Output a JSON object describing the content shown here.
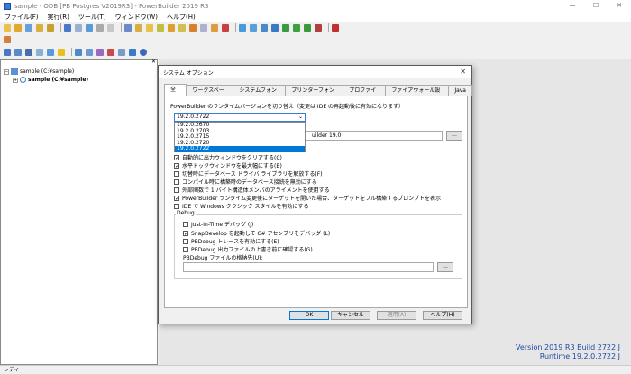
{
  "window": {
    "title": "sample - ODB [PB Postgres V2019R3] - PowerBuilder 2019 R3",
    "min_glyph": "—",
    "max_glyph": "☐",
    "close_glyph": "✕"
  },
  "menu": [
    "ファイル(F)",
    "実行(R)",
    "ツール(T)",
    "ウィンドウ(W)",
    "ヘルプ(H)"
  ],
  "tree": {
    "workspace": "sample (C:¥sample)",
    "target": "sample  (C:¥sample)"
  },
  "pane_close": "✕",
  "dialog": {
    "title": "システム オプション",
    "tabs": [
      "全般",
      "ワークスペース",
      "システムフォント",
      "プリンターフォント",
      "プロファイル",
      "ファイアウォール設定",
      "Java"
    ],
    "runtime_label": "PowerBuilder のランタイムバージョンを切り替え（変更は IDE の再起動後に有効になります）",
    "runtime_selected": "19.2.0.2722",
    "runtime_options": [
      "19.2.0.2670",
      "19.2.0.2703",
      "19.2.0.2715",
      "19.2.0.2720",
      "19.2.0.2722"
    ],
    "path_value": "uilder 19.0",
    "path_browse": "...",
    "checkboxes": [
      {
        "label": "自動的に出力ウィンドウをクリアする(C)",
        "checked": true
      },
      {
        "label": "水平ドックウィンドウを最大幅にする(B)",
        "checked": true
      },
      {
        "label": "切替時にデータベース ドライバ ライブラリを解放する(F)",
        "checked": false
      },
      {
        "label": "コンパイル時に構築時のデータベース接続を無効にする",
        "checked": false
      },
      {
        "label": "外部関数で 1 バイト構造体メンバのアライメントを使用する",
        "checked": false
      },
      {
        "label": "PowerBuilder ランタイム変更後にターゲットを開いた場合、ターゲットをフル構築するプロンプトを表示",
        "checked": true
      },
      {
        "label": "IDE で Windows クラシック スタイルを有効にする",
        "checked": false
      }
    ],
    "debug": {
      "group_label": "Debug",
      "options": [
        {
          "label": "Just-In-Time デバッグ (J)",
          "checked": false
        },
        {
          "label": "SnapDevelop を起動して C# アセンブリをデバッグ (L)",
          "checked": true
        },
        {
          "label": "PBDebug トレースを有効にする(E)",
          "checked": false
        },
        {
          "label": "PBDebug 出力ファイルの上書き前に確認する(G)",
          "checked": false
        }
      ],
      "file_label": "PBDebug ファイルの格納先(U):",
      "file_browse": "..."
    },
    "buttons": {
      "ok": "OK",
      "cancel": "キャンセル",
      "apply": "適用(A)",
      "help": "ヘルプ(H)"
    }
  },
  "version": {
    "line1": "Version 2019 R3 Build 2722.J",
    "line2": "Runtime 19.2.0.2722.J"
  },
  "status": "レディ",
  "colors": {
    "accent": "#0078d7",
    "version_text": "#1f4aa6"
  }
}
